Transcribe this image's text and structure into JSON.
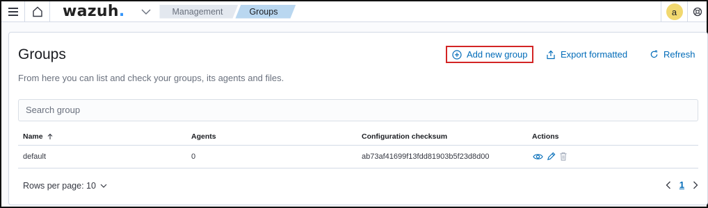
{
  "header": {
    "logo_text": "wazuh",
    "logo_dot": ".",
    "breadcrumbs": [
      "Management",
      "Groups"
    ],
    "avatar_letter": "a"
  },
  "page": {
    "title": "Groups",
    "description": "From here you can list and check your groups, its agents and files.",
    "actions": {
      "add": "Add new group",
      "export": "Export formatted",
      "refresh": "Refresh"
    }
  },
  "search": {
    "placeholder": "Search group"
  },
  "table": {
    "columns": [
      "Name",
      "Agents",
      "Configuration checksum",
      "Actions"
    ],
    "rows": [
      {
        "name": "default",
        "agents": "0",
        "checksum": "ab73af41699f13fdd81903b5f23d8d00"
      }
    ]
  },
  "pagination": {
    "rows_per_page_label": "Rows per page: 10",
    "current_page": "1"
  },
  "colors": {
    "accent": "#006bb8",
    "highlight_border": "#d32424",
    "avatar": "#f1d86f"
  }
}
